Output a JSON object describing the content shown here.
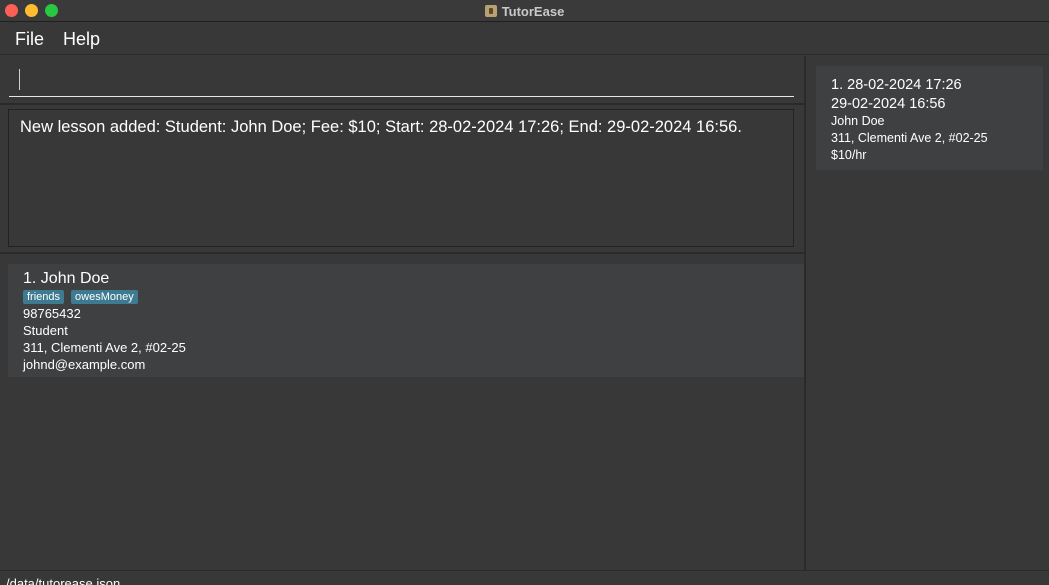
{
  "window": {
    "title": "TutorEase"
  },
  "menu": {
    "file": "File",
    "help": "Help"
  },
  "command": {
    "value": "",
    "placeholder": ""
  },
  "result": {
    "message": "New lesson added: Student: John Doe; Fee: $10; Start: 28-02-2024 17:26; End: 29-02-2024 16:56."
  },
  "persons": [
    {
      "index": "1.",
      "name": "John Doe",
      "tags": [
        "friends",
        "owesMoney"
      ],
      "phone": "98765432",
      "type": "Student",
      "address": "311, Clementi Ave 2, #02-25",
      "email": "johnd@example.com"
    }
  ],
  "lessons": [
    {
      "index": "1.",
      "start": "28-02-2024 17:26",
      "end": "29-02-2024 16:56",
      "student": "John Doe",
      "address": "311, Clementi Ave 2, #02-25",
      "fee": "$10/hr"
    }
  ],
  "status": {
    "path": "/data/tutorease.json"
  },
  "colors": {
    "background": "#383838",
    "card": "#3f4042",
    "tag": "#3e7b91"
  }
}
